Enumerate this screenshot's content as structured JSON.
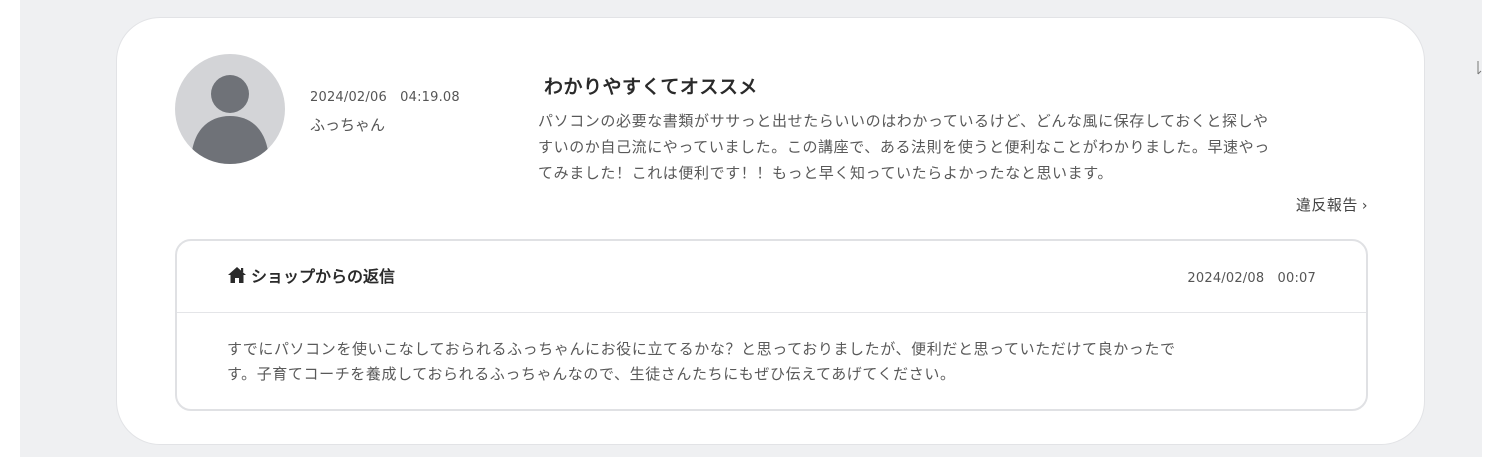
{
  "review": {
    "date": "2024/02/06　04:19.08",
    "reviewer_name": "ふっちゃん",
    "title": "わかりやすくてオススメ",
    "body_lines": [
      "パソコンの必要な書類がササっと出せたらいいのはわかっているけど、どんな風に保存しておくと探しや",
      "すいのか自己流にやっていました。この講座で、ある法則を使うと便利なことがわかりました。早速やっ",
      "てみました！これは便利です！！もっと早く知っていたらよかったなと思います。"
    ],
    "report_label": "違反報告",
    "report_chevron": "›"
  },
  "reply": {
    "title": "ショップからの返信",
    "date": "2024/02/08　00:07",
    "body_lines": [
      "すでにパソコンを使いこなしておられるふっちゃんにお役に立てるかな？と思っておりましたが、便利だと思っていただけて良かったで",
      "す。子育てコーチを養成しておられるふっちゃんなので、生徒さんたちにもぜひ伝えてあげてください。"
    ]
  },
  "colors": {
    "page_background": "#eff0f2",
    "card_background": "#ffffff",
    "avatar_background": "#d3d4d7",
    "avatar_figure": "#6f7278"
  },
  "icons": {
    "avatar": "user-silhouette-icon",
    "reply": "home-icon",
    "report": "chevron-right-icon"
  }
}
